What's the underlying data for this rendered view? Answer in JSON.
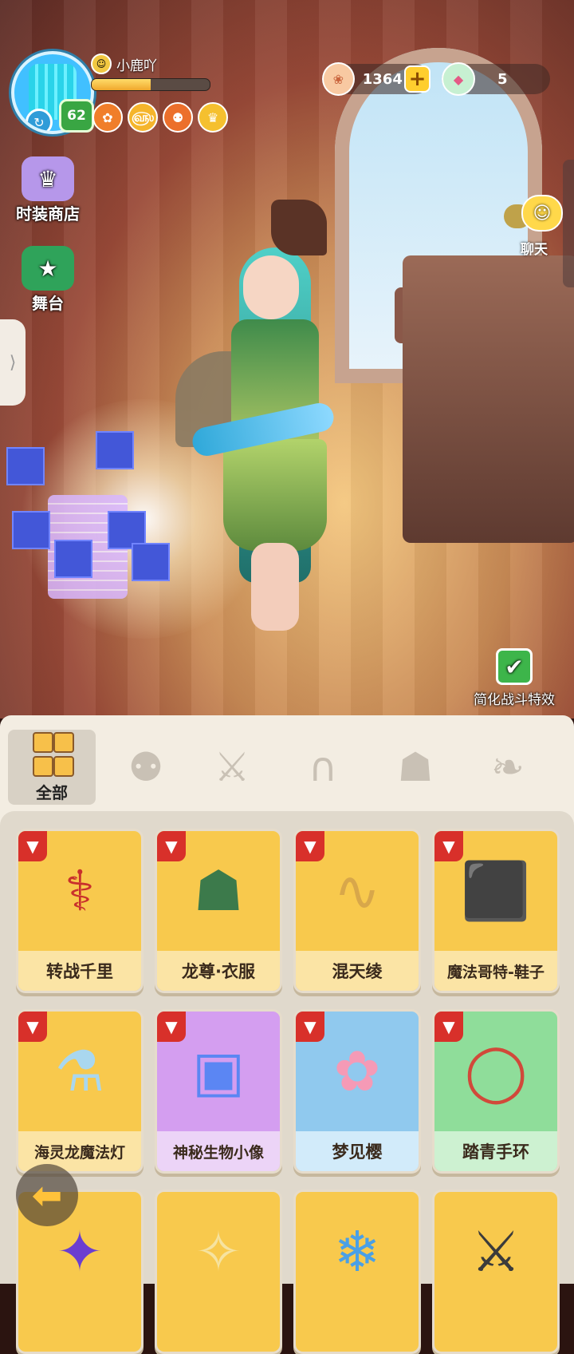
{
  "player": {
    "name": "小鹿吖",
    "level": "62",
    "avatar_badge_icon": "swirl-icon",
    "exp_fraction": 0.5
  },
  "currency": [
    {
      "icon": "shell-coin-icon",
      "amount": "1364",
      "has_plus": true
    },
    {
      "icon": "gem-icon",
      "amount": "5",
      "has_plus": false
    }
  ],
  "side_menu": {
    "fashion_shop": "时装商店",
    "stage": "舞台"
  },
  "chat": {
    "label": "聊天"
  },
  "battle_effects": {
    "label": "简化战斗特效",
    "checked": true
  },
  "tabs": {
    "all_label": "全部"
  },
  "items": [
    {
      "name": "转战千里",
      "color": "yellow",
      "tag": "shirt-icon"
    },
    {
      "name": "龙尊·衣服",
      "color": "yellow",
      "tag": "shirt-icon"
    },
    {
      "name": "混天绫",
      "color": "yellow",
      "tag": "shirt-icon"
    },
    {
      "name": "魔法哥特-鞋子",
      "color": "yellow",
      "tag": "shirt-icon"
    },
    {
      "name": "海灵龙魔法灯",
      "color": "yellow",
      "tag": "shirt-icon"
    },
    {
      "name": "神秘生物小像",
      "color": "purple",
      "tag": "shirt-icon"
    },
    {
      "name": "梦见樱",
      "color": "blue",
      "tag": "shirt-icon"
    },
    {
      "name": "踏青手环",
      "color": "green",
      "tag": "shirt-icon"
    }
  ]
}
